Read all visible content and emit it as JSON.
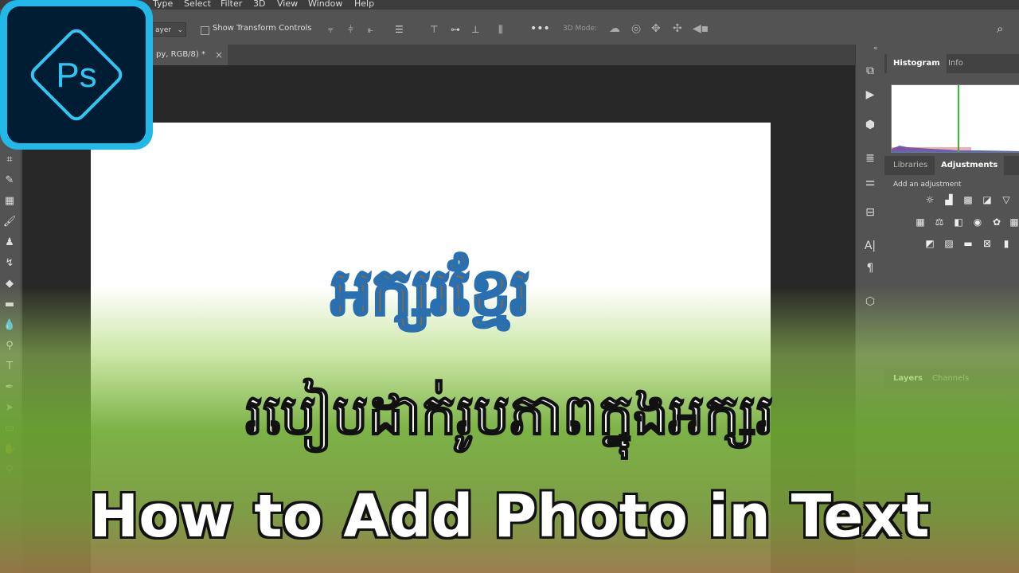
{
  "menu": [
    "Type",
    "Select",
    "Filter",
    "3D",
    "View",
    "Window",
    "Help"
  ],
  "options": {
    "layer_dropdown": "ayer",
    "show_transform": "Show Transform Controls",
    "mode_3d": "3D Mode:"
  },
  "document_tab": {
    "title": "py, RGB/8) *",
    "close": "×"
  },
  "panels": {
    "top_tabs": [
      "Histogram",
      "Info"
    ],
    "mid_tabs": [
      "Libraries",
      "Adjustments"
    ],
    "adjust_label": "Add an adjustment",
    "bottom_tabs": [
      "Layers",
      "Channels"
    ]
  },
  "logo": {
    "text": "Ps"
  },
  "overlay": {
    "khmer_title": "អក្សរខ្មែរ",
    "khmer_subtitle": "របៀបដាក់រូបភាពក្នុងអក្សរ",
    "english_title": "How to Add Photo in Text"
  },
  "colors": {
    "accent": "#22b8e8",
    "logo_bg": "#001d34",
    "green": "#7fb63a"
  }
}
